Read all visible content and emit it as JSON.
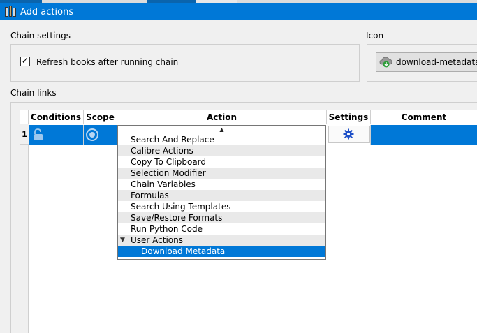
{
  "window": {
    "title": "Add actions"
  },
  "chain_settings": {
    "label": "Chain settings",
    "refresh_checkbox": {
      "checked": true,
      "check_mark": "✓",
      "label": "Refresh books after running chain"
    }
  },
  "icon_section": {
    "label": "Icon",
    "button_label": "download-metadata.",
    "icon": "cloud-download-icon"
  },
  "chain_links": {
    "label": "Chain links",
    "columns": [
      "Conditions",
      "Scope",
      "Action",
      "Settings",
      "Comment"
    ],
    "rows": [
      {
        "number": "1",
        "conditions_icon": "unlock-icon",
        "scope_icon": "radio-target-icon",
        "settings_icon": "gear-icon",
        "comment": ""
      }
    ]
  },
  "action_dropdown": {
    "scroll_up_glyph": "▲",
    "items": [
      {
        "label": "Search And Replace"
      },
      {
        "label": "Calibre Actions"
      },
      {
        "label": "Copy To Clipboard"
      },
      {
        "label": "Selection Modifier"
      },
      {
        "label": "Chain Variables"
      },
      {
        "label": "Formulas"
      },
      {
        "label": "Search Using Templates"
      },
      {
        "label": "Save/Restore Formats"
      },
      {
        "label": "Run Python Code"
      },
      {
        "label": "User Actions",
        "expanded": true,
        "expand_glyph": "▼"
      },
      {
        "label": "Download Metadata",
        "selected": true,
        "child": true
      }
    ]
  },
  "colors": {
    "accent": "#0078d7",
    "titlebar": "#0078d7",
    "window_bg": "#f0f0f0",
    "gear": "#1e50c8"
  }
}
